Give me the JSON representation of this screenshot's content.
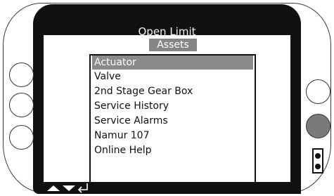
{
  "header": {
    "title": "Open Limit",
    "subtitle": "Assets"
  },
  "menu": {
    "items": [
      {
        "label": "Actuator",
        "selected": true
      },
      {
        "label": "Valve"
      },
      {
        "label": "2nd Stage Gear Box"
      },
      {
        "label": "Service History"
      },
      {
        "label": "Service Alarms"
      },
      {
        "label": "Namur 107"
      },
      {
        "label": "Online Help"
      }
    ]
  },
  "nav": {
    "icons": [
      "up-arrow-icon",
      "down-arrow-icon",
      "enter-icon"
    ]
  },
  "colors": {
    "bezel": "#111111",
    "highlight": "#8a8a8a",
    "knob_filled": "#7a7a7a"
  }
}
